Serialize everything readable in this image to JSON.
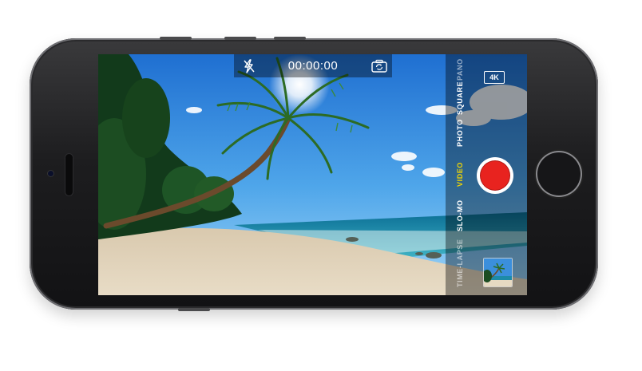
{
  "window": {
    "title": ""
  },
  "camera": {
    "timer": "00:00:00",
    "flash_icon": "flash-off-icon",
    "switch_icon": "camera-switch-icon",
    "resolution_badge": "4K",
    "modes": [
      {
        "label": "PANO",
        "state": "faded"
      },
      {
        "label": "SQUARE",
        "state": "normal"
      },
      {
        "label": "PHOTO",
        "state": "normal"
      },
      {
        "label": "VIDEO",
        "state": "active"
      },
      {
        "label": "SLO-MO",
        "state": "normal"
      },
      {
        "label": "TIME-LAPSE",
        "state": "faded"
      }
    ],
    "record_button_color": "#e8231f",
    "active_mode_color": "#f3d600",
    "thumbnail_icon": "last-photo-thumbnail"
  }
}
